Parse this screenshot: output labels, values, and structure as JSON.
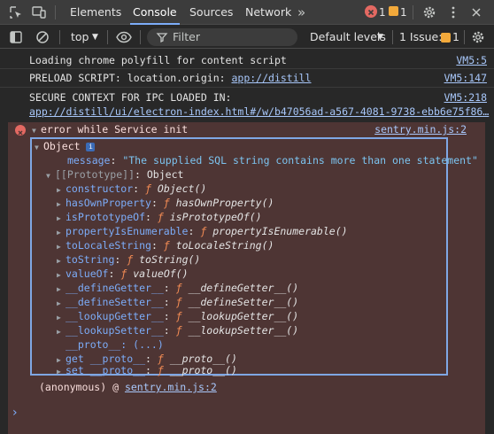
{
  "tabbar": {
    "tabs": [
      {
        "label": "Elements"
      },
      {
        "label": "Console"
      },
      {
        "label": "Sources"
      },
      {
        "label": "Network"
      }
    ],
    "more": "»",
    "error_count": "1",
    "warning_count": "1"
  },
  "toolbar": {
    "context": "top",
    "filter_placeholder": "Filter",
    "levels": "Default levels",
    "issues_label": "1 Issue:",
    "issues_count": "1"
  },
  "logs": [
    {
      "text": "Loading chrome polyfill for content script",
      "source": "VM5:5"
    },
    {
      "text_prefix": "PRELOAD SCRIPT: location.origin: ",
      "text_link": "app://distill",
      "source": "VM5:147"
    },
    {
      "text": "SECURE CONTEXT FOR IPC LOADED IN:",
      "link": "app://distill/ui/electron-index.html#/w/b47056ad-a567-4081-9738-ebb6e75f86…",
      "source": "VM5:218"
    }
  ],
  "error": {
    "title": "error while Service init",
    "source": "sentry.min.js:2",
    "object_label": "Object",
    "info_icon": "i",
    "message_key": "message",
    "message_value": "\"The supplied SQL string contains more than one statement\"",
    "prototype_key": "[[Prototype]]",
    "prototype_value": "Object",
    "members": [
      {
        "key": "constructor",
        "fn": "Object()"
      },
      {
        "key": "hasOwnProperty",
        "fn": "hasOwnProperty()"
      },
      {
        "key": "isPrototypeOf",
        "fn": "isPrototypeOf()"
      },
      {
        "key": "propertyIsEnumerable",
        "fn": "propertyIsEnumerable()"
      },
      {
        "key": "toLocaleString",
        "fn": "toLocaleString()"
      },
      {
        "key": "toString",
        "fn": "toString()"
      },
      {
        "key": "valueOf",
        "fn": "valueOf()"
      },
      {
        "key": "__defineGetter__",
        "fn": "__defineGetter__()"
      },
      {
        "key": "__defineSetter__",
        "fn": "__defineSetter__()"
      },
      {
        "key": "__lookupGetter__",
        "fn": "__lookupGetter__()"
      },
      {
        "key": "__lookupSetter__",
        "fn": "__lookupSetter__()"
      }
    ],
    "proto_line": "__proto__: (...)",
    "getter": {
      "key": "get __proto__",
      "fn": "__proto__()"
    },
    "setter": {
      "key": "set __proto__",
      "fn": "__proto__()"
    },
    "f_glyph": "ƒ",
    "stack_prefix": "(anonymous) @ ",
    "stack_link": "sentry.min.js:2"
  },
  "prompt": "›"
}
